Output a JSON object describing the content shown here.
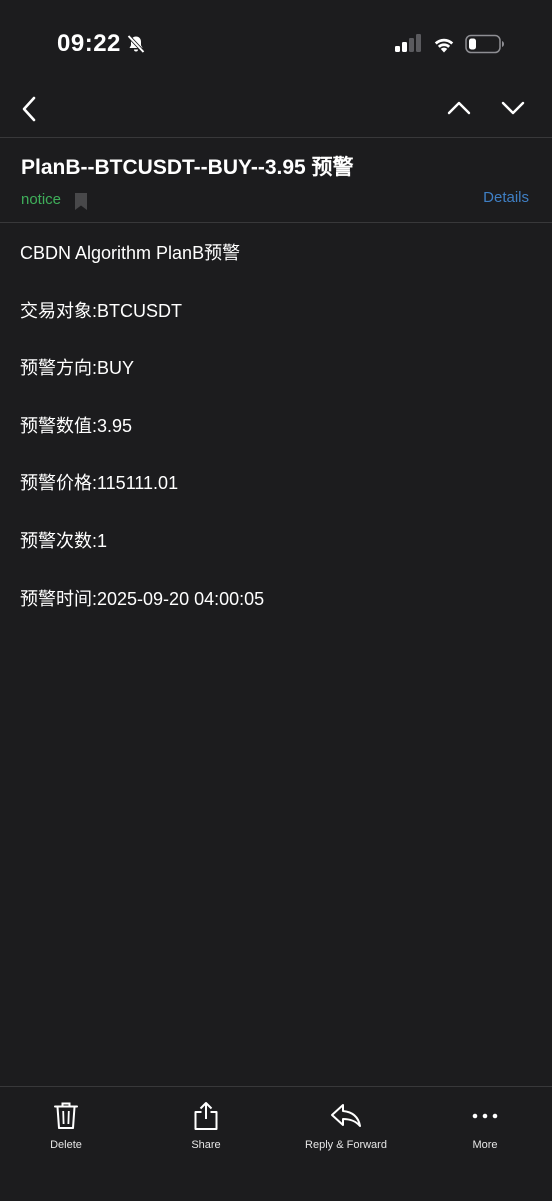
{
  "status_bar": {
    "time": "09:22",
    "icons": [
      "bell-slash-icon",
      "cellular-signal-icon",
      "wifi-icon",
      "battery-icon"
    ]
  },
  "nav": {
    "back_icon": "chevron-left-icon",
    "prev_icon": "chevron-up-icon",
    "next_icon": "chevron-down-icon"
  },
  "message": {
    "subject": "PlanB--BTCUSDT--BUY--3.95 预警",
    "tag": "notice",
    "tag_color": "#3fae5a",
    "details_label": "Details",
    "link_color": "#3f7fc4",
    "body_lines": [
      "CBDN Algorithm PlanB预警",
      "交易对象:BTCUSDT",
      "预警方向:BUY",
      "预警数值:3.95",
      "预警价格:115111.01",
      "预警次数:1",
      "预警时间:2025-09-20 04:00:05"
    ]
  },
  "toolbar": {
    "delete_label": "Delete",
    "share_label": "Share",
    "reply_label": "Reply & Forward",
    "more_label": "More"
  },
  "colors": {
    "background": "#1c1c1e",
    "divider": "#38383a",
    "text": "#ffffff"
  }
}
